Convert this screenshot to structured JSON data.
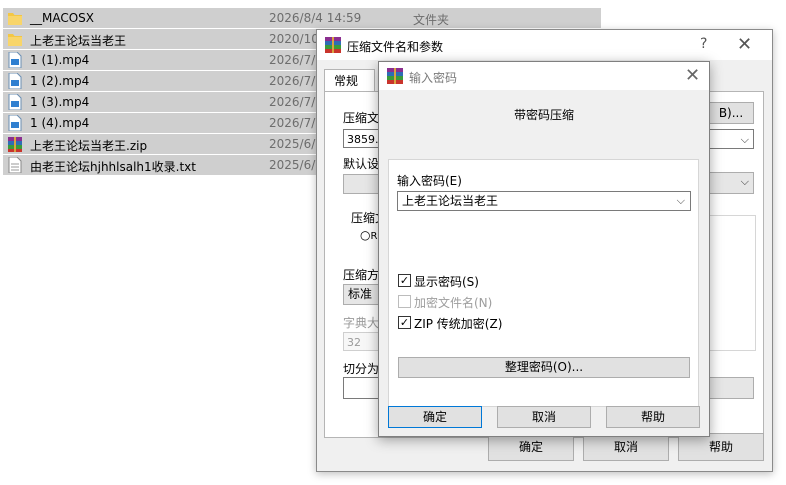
{
  "explorer": {
    "files": [
      {
        "name": "__MACOSX",
        "date": "2026/8/4 14:59",
        "type": "文件夹",
        "icon": "folder-icon"
      },
      {
        "name": "上老王论坛当老王",
        "date": "2020/10/",
        "type": "",
        "icon": "folder-icon"
      },
      {
        "name": "1 (1).mp4",
        "date": "2026/7/1",
        "type": "",
        "icon": "video-file-icon"
      },
      {
        "name": "1 (2).mp4",
        "date": "2026/7/1",
        "type": "",
        "icon": "video-file-icon"
      },
      {
        "name": "1 (3).mp4",
        "date": "2026/7/1",
        "type": "",
        "icon": "video-file-icon"
      },
      {
        "name": "1 (4).mp4",
        "date": "2026/7/1",
        "type": "",
        "icon": "video-file-icon"
      },
      {
        "name": "上老王论坛当老王.zip",
        "date": "2025/6/1",
        "type": "",
        "icon": "winrar-archive-icon"
      },
      {
        "name": "由老王论坛hjhhlsalh1收录.txt",
        "date": "2025/6/1",
        "type": "",
        "icon": "text-file-icon"
      }
    ]
  },
  "archive_dialog": {
    "title": "压缩文件名和参数",
    "help_glyph": "?",
    "close_glyph": "✕",
    "tab_general": "常规",
    "archive_name_label": "压缩文",
    "archive_name_value": "3859.z",
    "browse_label": "B)...",
    "default_profile_label": "默认设",
    "update_mode_label": "压缩文",
    "radio_label": "R",
    "compression_method_label": "压缩方",
    "compression_method_value": "标准",
    "dictionary_label": "字典大",
    "dictionary_value": "32",
    "split_label": "切分为",
    "ok_label": "确定",
    "cancel_label": "取消",
    "help_label": "帮助"
  },
  "password_dialog": {
    "title": "输入密码",
    "close_glyph": "✕",
    "heading": "带密码压缩",
    "enter_password_label": "输入密码(E)",
    "password_value": "上老王论坛当老王",
    "show_password_label": "显示密码(S)",
    "show_password_checked": true,
    "encrypt_names_label": "加密文件名(N)",
    "encrypt_names_checked": false,
    "zip_legacy_label": "ZIP 传统加密(Z)",
    "zip_legacy_checked": true,
    "organize_label": "整理密码(O)...",
    "ok_label": "确定",
    "cancel_label": "取消",
    "help_label": "帮助"
  }
}
